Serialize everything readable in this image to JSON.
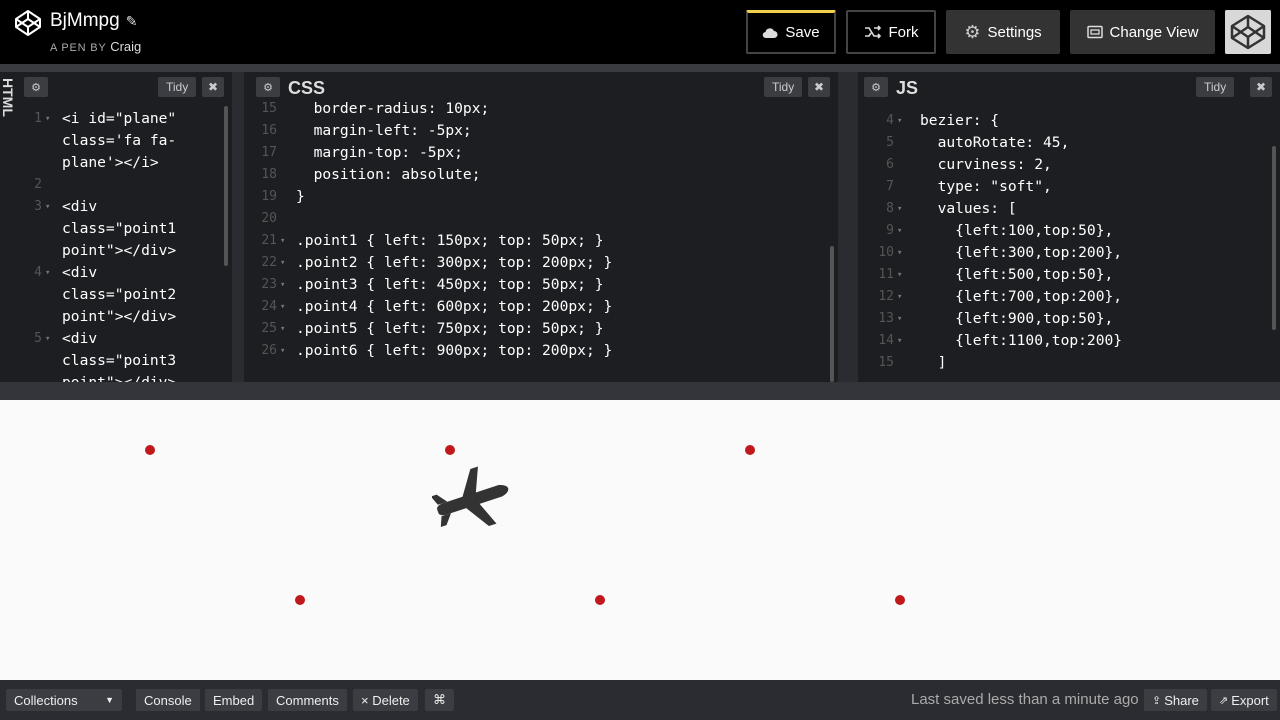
{
  "header": {
    "pen_title": "BjMmpg",
    "pen_by_label": "A PEN BY",
    "author": "Craig",
    "buttons": {
      "save": "Save",
      "fork": "Fork",
      "settings": "Settings",
      "change_view": "Change View"
    }
  },
  "html_panel": {
    "label": "HTML",
    "tidy": "Tidy",
    "close": "✖",
    "lines": [
      {
        "n": "1",
        "fold": true,
        "text": "<i id=\"plane\""
      },
      {
        "n": "",
        "fold": false,
        "text": "class='fa fa-"
      },
      {
        "n": "",
        "fold": false,
        "text": "plane'></i>"
      },
      {
        "n": "2",
        "fold": false,
        "text": ""
      },
      {
        "n": "3",
        "fold": true,
        "text": "<div"
      },
      {
        "n": "",
        "fold": false,
        "text": "class=\"point1"
      },
      {
        "n": "",
        "fold": false,
        "text": "point\"></div>"
      },
      {
        "n": "4",
        "fold": true,
        "text": "<div"
      },
      {
        "n": "",
        "fold": false,
        "text": "class=\"point2"
      },
      {
        "n": "",
        "fold": false,
        "text": "point\"></div>"
      },
      {
        "n": "5",
        "fold": true,
        "text": "<div"
      },
      {
        "n": "",
        "fold": false,
        "text": "class=\"point3"
      },
      {
        "n": "",
        "fold": false,
        "text": "point\"></div>"
      }
    ]
  },
  "css_panel": {
    "label": "CSS",
    "tidy": "Tidy",
    "close": "✖",
    "lines": [
      {
        "n": "15",
        "fold": false,
        "text": "  border-radius: 10px;"
      },
      {
        "n": "16",
        "fold": false,
        "text": "  margin-left: -5px;"
      },
      {
        "n": "17",
        "fold": false,
        "text": "  margin-top: -5px;"
      },
      {
        "n": "18",
        "fold": false,
        "text": "  position: absolute;"
      },
      {
        "n": "19",
        "fold": false,
        "text": "}"
      },
      {
        "n": "20",
        "fold": false,
        "text": ""
      },
      {
        "n": "21",
        "fold": true,
        "text": ".point1 { left: 150px; top: 50px; }"
      },
      {
        "n": "22",
        "fold": true,
        "text": ".point2 { left: 300px; top: 200px; }"
      },
      {
        "n": "23",
        "fold": true,
        "text": ".point3 { left: 450px; top: 50px; }"
      },
      {
        "n": "24",
        "fold": true,
        "text": ".point4 { left: 600px; top: 200px; }"
      },
      {
        "n": "25",
        "fold": true,
        "text": ".point5 { left: 750px; top: 50px; }"
      },
      {
        "n": "26",
        "fold": true,
        "text": ".point6 { left: 900px; top: 200px; }"
      }
    ]
  },
  "js_panel": {
    "label": "JS",
    "tidy": "Tidy",
    "close": "✖",
    "lines": [
      {
        "n": "4",
        "fold": true,
        "text": "bezier: {"
      },
      {
        "n": "5",
        "fold": false,
        "text": "  autoRotate: 45,"
      },
      {
        "n": "6",
        "fold": false,
        "text": "  curviness: 2,"
      },
      {
        "n": "7",
        "fold": false,
        "text": "  type: \"soft\","
      },
      {
        "n": "8",
        "fold": true,
        "text": "  values: ["
      },
      {
        "n": "9",
        "fold": true,
        "text": "    {left:100,top:50},"
      },
      {
        "n": "10",
        "fold": true,
        "text": "    {left:300,top:200},"
      },
      {
        "n": "11",
        "fold": true,
        "text": "    {left:500,top:50},"
      },
      {
        "n": "12",
        "fold": true,
        "text": "    {left:700,top:200},"
      },
      {
        "n": "13",
        "fold": true,
        "text": "    {left:900,top:50},"
      },
      {
        "n": "14",
        "fold": true,
        "text": "    {left:1100,top:200}"
      },
      {
        "n": "15",
        "fold": false,
        "text": "  ]"
      }
    ]
  },
  "footer": {
    "collections": "Collections",
    "console": "Console",
    "embed": "Embed",
    "comments": "Comments",
    "delete": "× Delete",
    "keyboard": "⌘",
    "saved_status": "Last saved less than a minute ago",
    "share": "Share",
    "export": "Export"
  },
  "colors": {
    "accent_save": "#f2d14a",
    "point_dot": "#c0181b",
    "editor_bg": "#1d1e22",
    "result_bg": "#fafafa"
  },
  "icons": [
    "codepen-logo-icon",
    "pencil-icon",
    "cloud-icon",
    "fork-icon",
    "gear-icon",
    "change-view-icon",
    "close-icon",
    "plane-icon",
    "chevron-down-icon",
    "share-icon",
    "export-icon"
  ]
}
